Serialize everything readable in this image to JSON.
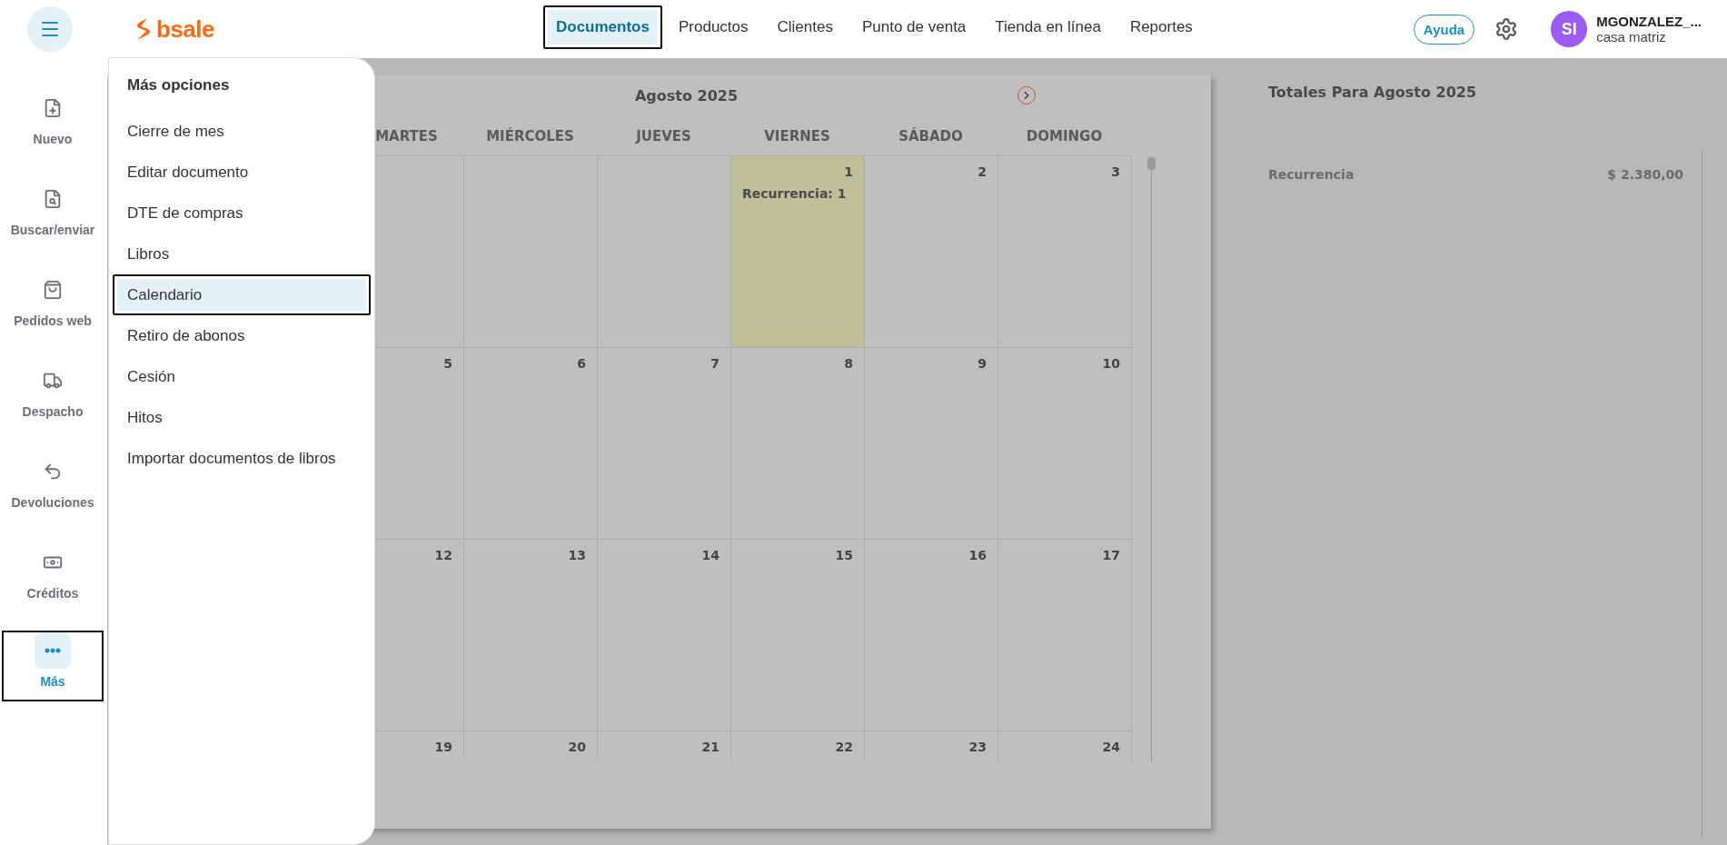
{
  "top_bar": {
    "logo": "bsale",
    "nav": [
      {
        "label": "Documentos",
        "selected": true
      },
      {
        "label": "Productos",
        "selected": false
      },
      {
        "label": "Clientes",
        "selected": false
      },
      {
        "label": "Punto de venta",
        "selected": false
      },
      {
        "label": "Tienda en línea",
        "selected": false
      },
      {
        "label": "Reportes",
        "selected": false
      }
    ],
    "help": "Ayuda",
    "user": {
      "initials": "SI",
      "name": "MGONZALEZ_...",
      "branch": "casa matriz"
    }
  },
  "sidebar": {
    "items": [
      {
        "kind": "new",
        "label": "Nuevo",
        "selected": false
      },
      {
        "kind": "search",
        "label": "Buscar/enviar",
        "selected": false
      },
      {
        "kind": "orders",
        "label": "Pedidos web",
        "selected": false
      },
      {
        "kind": "dispatch",
        "label": "Despacho",
        "selected": false
      },
      {
        "kind": "returns",
        "label": "Devoluciones",
        "selected": false
      },
      {
        "kind": "credits",
        "label": "Créditos",
        "selected": false
      },
      {
        "kind": "more",
        "label": "Más",
        "selected": true
      }
    ]
  },
  "menu": {
    "title": "Más opciones",
    "items": [
      {
        "label": "Cierre de mes",
        "selected": false
      },
      {
        "label": "Editar documento",
        "selected": false
      },
      {
        "label": "DTE de compras",
        "selected": false
      },
      {
        "label": "Libros",
        "selected": false
      },
      {
        "label": "Calendario",
        "selected": true
      },
      {
        "label": "Retiro de abonos",
        "selected": false
      },
      {
        "label": "Cesión",
        "selected": false
      },
      {
        "label": "Hitos",
        "selected": false
      },
      {
        "label": "Importar documentos de libros",
        "selected": false
      }
    ]
  },
  "calendar": {
    "title": "Agosto 2025",
    "weekdays": [
      "MARTES",
      "MIÉRCOLES",
      "JUEVES",
      "VIERNES",
      "SÁBADO",
      "DOMINGO"
    ],
    "weeks": [
      [
        {
          "kind": "blank"
        },
        {
          "kind": "blank"
        },
        {
          "kind": "blank"
        },
        {
          "kind": "day",
          "day": "1",
          "highlighted": true,
          "event": "Recurrencia: 1"
        },
        {
          "kind": "day",
          "day": "2",
          "highlighted": false
        },
        {
          "kind": "day",
          "day": "3",
          "highlighted": false
        }
      ],
      [
        {
          "kind": "day",
          "day": "5",
          "highlighted": false
        },
        {
          "kind": "day",
          "day": "6",
          "highlighted": false
        },
        {
          "kind": "day",
          "day": "7",
          "highlighted": false
        },
        {
          "kind": "day",
          "day": "8",
          "highlighted": false
        },
        {
          "kind": "day",
          "day": "9",
          "highlighted": false
        },
        {
          "kind": "day",
          "day": "10",
          "highlighted": false
        }
      ],
      [
        {
          "kind": "day",
          "day": "12",
          "highlighted": false
        },
        {
          "kind": "day",
          "day": "13",
          "highlighted": false
        },
        {
          "kind": "day",
          "day": "14",
          "highlighted": false
        },
        {
          "kind": "day",
          "day": "15",
          "highlighted": false
        },
        {
          "kind": "day",
          "day": "16",
          "highlighted": false
        },
        {
          "kind": "day",
          "day": "17",
          "highlighted": false
        }
      ],
      [
        {
          "kind": "day",
          "day": "19",
          "highlighted": false
        },
        {
          "kind": "day",
          "day": "20",
          "highlighted": false
        },
        {
          "kind": "day",
          "day": "21",
          "highlighted": false
        },
        {
          "kind": "day",
          "day": "22",
          "highlighted": false
        },
        {
          "kind": "day",
          "day": "23",
          "highlighted": false
        },
        {
          "kind": "day",
          "day": "24",
          "highlighted": false
        }
      ]
    ]
  },
  "totals": {
    "title": "Totales Para Agosto 2025",
    "rows": [
      {
        "label": "Recurrencia",
        "value": "$ 2.380,00"
      }
    ]
  }
}
